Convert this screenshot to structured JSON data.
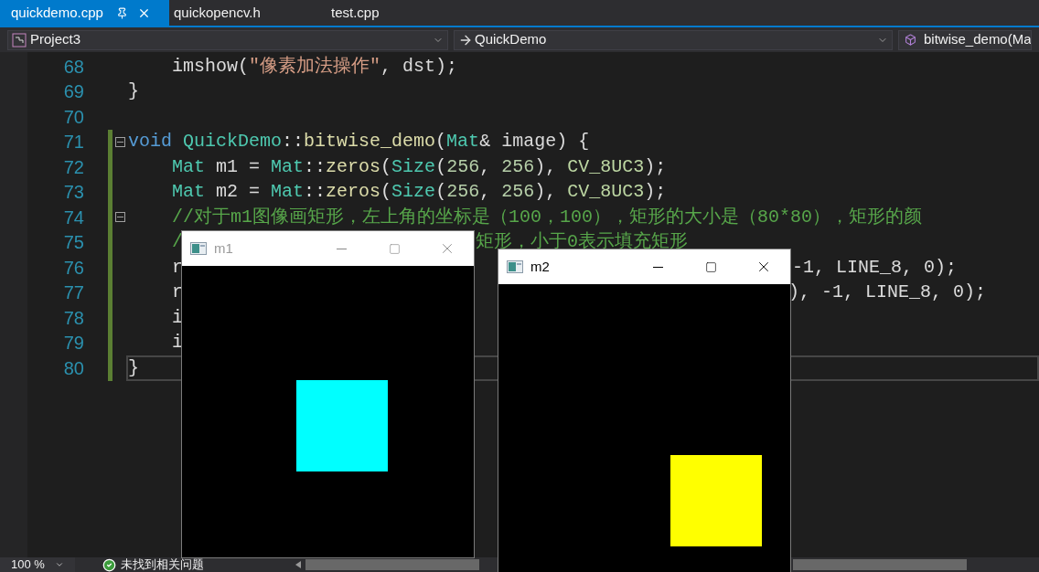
{
  "tabs": [
    {
      "label": "quickdemo.cpp",
      "selected": true
    },
    {
      "label": "quickopencv.h",
      "selected": false
    },
    {
      "label": "test.cpp",
      "selected": false
    }
  ],
  "navigation_bar": {
    "project": "Project3",
    "scope": "QuickDemo",
    "member": "bitwise_demo(Ma"
  },
  "editor": {
    "lines": [
      {
        "number": "68",
        "indented": true,
        "changed": false,
        "collapsible": false,
        "current": false,
        "segments": [
          [
            {
              "kind": "plain",
              "text": "imshow("
            },
            {
              "kind": "str",
              "text": "\"像素加法操作\""
            },
            {
              "kind": "plain",
              "text": ","
            },
            {
              "kind": "var",
              "text": " dst"
            },
            {
              "kind": "plain",
              "text": ");"
            }
          ]
        ]
      },
      {
        "number": "69",
        "indented": false,
        "changed": false,
        "collapsible": false,
        "current": false,
        "segments": [
          [
            {
              "kind": "plain",
              "text": "}"
            }
          ]
        ]
      },
      {
        "number": "70",
        "indented": false,
        "changed": false,
        "collapsible": false,
        "current": false
      },
      {
        "number": "71",
        "indented": false,
        "changed": true,
        "collapsible": true,
        "current": false,
        "segments": [
          [
            {
              "kind": "keyword",
              "text": "void"
            },
            {
              "kind": "type",
              "text": " QuickDemo"
            },
            {
              "kind": "plain",
              "text": "::"
            },
            {
              "kind": "func",
              "text": "bitwise_demo"
            },
            {
              "kind": "plain",
              "text": "("
            },
            {
              "kind": "type",
              "text": "Mat"
            },
            {
              "kind": "plain",
              "text": "&"
            },
            {
              "kind": "var",
              "text": " image"
            },
            {
              "kind": "plain",
              "text": ") {"
            }
          ]
        ]
      },
      {
        "number": "72",
        "indented": true,
        "changed": true,
        "collapsible": false,
        "current": false,
        "segments": [
          [
            {
              "kind": "type",
              "text": "Mat"
            },
            {
              "kind": "var",
              "text": " m1"
            },
            {
              "kind": "plain",
              "text": " = "
            },
            {
              "kind": "type",
              "text": "Mat"
            },
            {
              "kind": "plain",
              "text": "::"
            },
            {
              "kind": "func",
              "text": "zeros"
            },
            {
              "kind": "plain",
              "text": "("
            },
            {
              "kind": "type",
              "text": "Size"
            },
            {
              "kind": "plain",
              "text": "("
            },
            {
              "kind": "num",
              "text": "256"
            },
            {
              "kind": "plain",
              "text": ","
            },
            {
              "kind": "num",
              "text": " 256"
            },
            {
              "kind": "plain",
              "text": "),"
            },
            {
              "kind": "macro",
              "text": " CV_8UC3"
            },
            {
              "kind": "plain",
              "text": ");"
            }
          ]
        ]
      },
      {
        "number": "73",
        "indented": true,
        "changed": true,
        "collapsible": false,
        "current": false,
        "segments": [
          [
            {
              "kind": "type",
              "text": "Mat"
            },
            {
              "kind": "var",
              "text": " m2"
            },
            {
              "kind": "plain",
              "text": " = "
            },
            {
              "kind": "type",
              "text": "Mat"
            },
            {
              "kind": "plain",
              "text": "::"
            },
            {
              "kind": "func",
              "text": "zeros"
            },
            {
              "kind": "plain",
              "text": "("
            },
            {
              "kind": "type",
              "text": "Size"
            },
            {
              "kind": "plain",
              "text": "("
            },
            {
              "kind": "num",
              "text": "256"
            },
            {
              "kind": "plain",
              "text": ","
            },
            {
              "kind": "num",
              "text": " 256"
            },
            {
              "kind": "plain",
              "text": "),"
            },
            {
              "kind": "macro",
              "text": " CV_8UC3"
            },
            {
              "kind": "plain",
              "text": ");"
            }
          ]
        ]
      },
      {
        "number": "74",
        "indented": true,
        "changed": true,
        "collapsible": true,
        "current": false,
        "segments": [
          [
            {
              "kind": "comment",
              "text": "//对于m1图像画矩形，左上角的坐标是（100，100），矩形的大小是（80*80），矩形的颜"
            }
          ]
        ]
      },
      {
        "number": "75",
        "indented": true,
        "changed": true,
        "collapsible": false,
        "current": false,
        "segments": [
          [
            {
              "kind": "comment",
              "text": "/"
            }
          ],
          [
            {
              "kind": "comment",
              "text": "矩形，小于0表示填充矩形"
            }
          ]
        ]
      },
      {
        "number": "76",
        "indented": true,
        "changed": true,
        "collapsible": false,
        "current": false,
        "segments": [
          [
            {
              "kind": "plain",
              "text": "r"
            }
          ],
          [
            {
              "kind": "plain",
              "text": "-1, LINE_8, 0);"
            }
          ]
        ]
      },
      {
        "number": "77",
        "indented": true,
        "changed": true,
        "collapsible": false,
        "current": false,
        "segments": [
          [
            {
              "kind": "plain",
              "text": "r"
            }
          ],
          [
            {
              "kind": "plain",
              "text": "), -1, LINE_8, 0);"
            }
          ]
        ]
      },
      {
        "number": "78",
        "indented": true,
        "changed": true,
        "collapsible": false,
        "current": false,
        "segments": [
          [
            {
              "kind": "plain",
              "text": "i"
            }
          ]
        ]
      },
      {
        "number": "79",
        "indented": true,
        "changed": true,
        "collapsible": false,
        "current": false,
        "segments": [
          [
            {
              "kind": "plain",
              "text": "i"
            }
          ]
        ]
      },
      {
        "number": "80",
        "indented": false,
        "changed": true,
        "collapsible": false,
        "current": true,
        "segments": [
          [
            {
              "kind": "plain",
              "text": "}"
            }
          ]
        ]
      }
    ]
  },
  "image_windows": [
    {
      "title": "m1",
      "active": false,
      "color": "#00ffff"
    },
    {
      "title": "m2",
      "active": true,
      "color": "#ffff00"
    }
  ],
  "status_bar": {
    "zoom": "100 %",
    "issues": "未找到相关问题"
  }
}
